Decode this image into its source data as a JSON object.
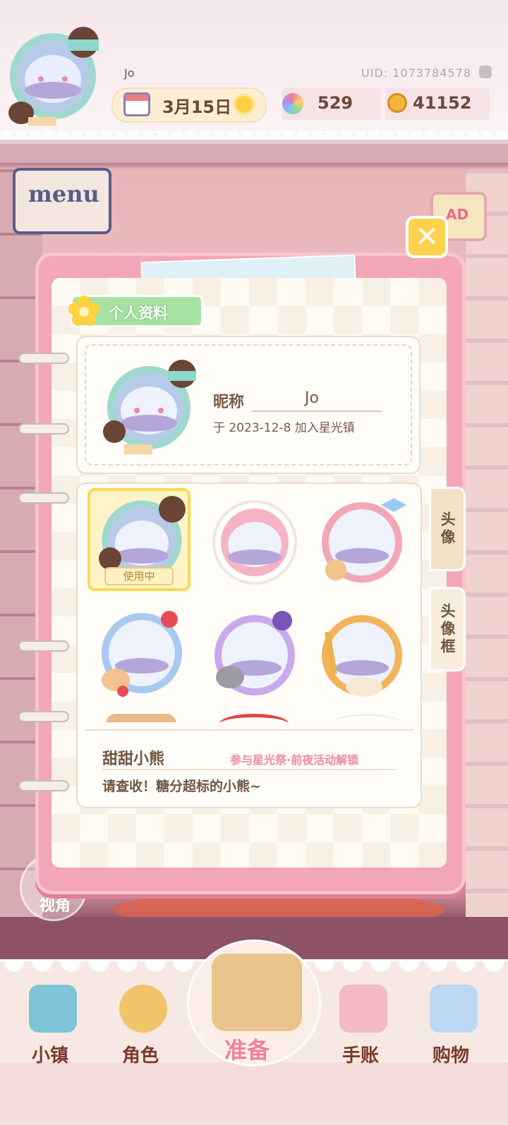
{
  "header": {
    "player_name": "Jo",
    "uid": "UID: 1073784578",
    "date": "3月15日",
    "gems": "529",
    "coins": "41152"
  },
  "side_buttons": {
    "menu_label": "menu",
    "ad_label": "AD",
    "close_symbol": "✕",
    "view_label": "视角"
  },
  "profile": {
    "section_title": "个人资料",
    "nickname_label": "昵称",
    "nickname_value": "Jo",
    "join_text": "于 2023-12-8 加入星光镇"
  },
  "grid": {
    "in_use_badge": "使用中"
  },
  "selected_item": {
    "name": "甜甜小熊",
    "source": "参与星光祭·前夜活动解锁",
    "description": "请查收！糖分超标的小熊~"
  },
  "tabs": {
    "avatar": "头像",
    "frame": "头像框"
  },
  "bottom_nav": {
    "town": "小镇",
    "character": "角色",
    "prepare": "准备",
    "journal": "手账",
    "shopping": "购物"
  },
  "colors": {
    "accent_pink": "#f3a6b6",
    "highlight_yellow": "#ffd84d",
    "tag_green": "#a6e3a3",
    "nav_text": "#7c3a2c"
  },
  "icons": [
    "calendar-icon",
    "sun-icon",
    "gem-icon",
    "coin-icon",
    "copy-icon",
    "flower-icon",
    "close-icon",
    "map-icon",
    "character-icon",
    "basket-icon",
    "journal-icon",
    "shopping-bag-icon"
  ]
}
